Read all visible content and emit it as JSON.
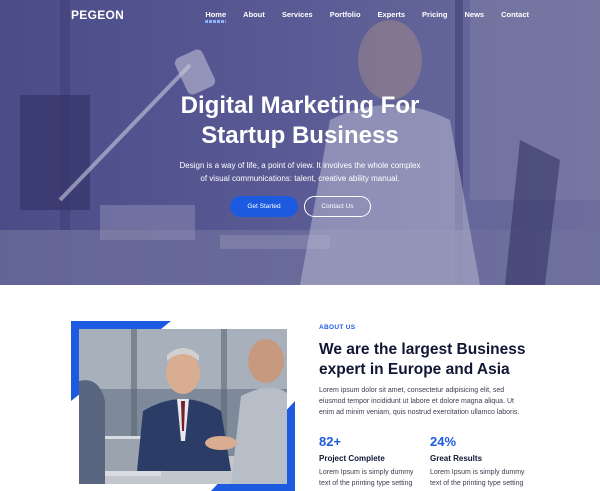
{
  "brand": {
    "logo_text": "PEGEON"
  },
  "nav": {
    "items": [
      {
        "label": "Home",
        "active": true
      },
      {
        "label": "About"
      },
      {
        "label": "Services"
      },
      {
        "label": "Portfolio"
      },
      {
        "label": "Experts"
      },
      {
        "label": "Pricing"
      },
      {
        "label": "News"
      },
      {
        "label": "Contact"
      }
    ]
  },
  "hero": {
    "title_lines": [
      "Digital Marketing For",
      "Startup Business"
    ],
    "subtitle_lines": [
      "Design is a way of life, a point of view. It involves the whole complex",
      "of visual communications: talent, creative ability manual."
    ],
    "primary_button": "Get Started",
    "secondary_button": "Contact Us"
  },
  "about": {
    "kicker": "ABOUT US",
    "title_lines": [
      "We are the largest Business",
      "expert in Europe and Asia"
    ],
    "text_lines": [
      "Lorem ipsum dolor sit amet, consectetur adipisicing elit, sed",
      "eiusmod tempor incididunt ut labore et dolore magna aliqua. Ut",
      "enim ad minim veniam, quis nostrud exercitation ullamco laboris."
    ],
    "stats": [
      {
        "number": "82+",
        "label": "Project Complete",
        "desc_lines": [
          "Lorem Ipsum is simply dummy",
          "text of the printing type setting"
        ]
      },
      {
        "number": "24%",
        "label": "Great Results",
        "desc_lines": [
          "Lorem Ipsum is simply dummy",
          "text of the printing type setting"
        ]
      }
    ]
  },
  "colors": {
    "accent": "#1c5be0",
    "hero_overlay": "#3b3f86",
    "heading": "#111633"
  }
}
